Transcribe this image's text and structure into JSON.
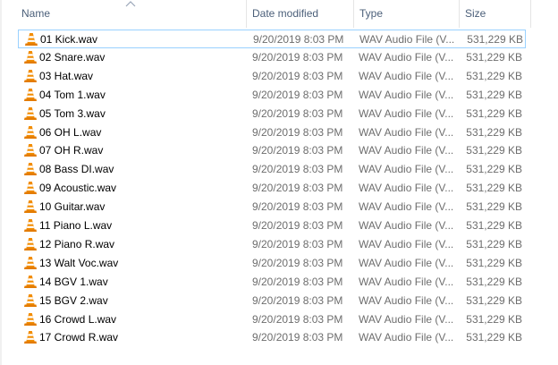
{
  "columns": {
    "name": "Name",
    "date": "Date modified",
    "type": "Type",
    "size": "Size"
  },
  "sort": {
    "column": "Name",
    "direction": "ascending"
  },
  "file_icon": "vlc-cone-icon",
  "files": [
    {
      "name": "01 Kick.wav",
      "date": "9/20/2019 8:03 PM",
      "type": "WAV Audio File (V...",
      "size": "531,229 KB"
    },
    {
      "name": "02 Snare.wav",
      "date": "9/20/2019 8:03 PM",
      "type": "WAV Audio File (V...",
      "size": "531,229 KB"
    },
    {
      "name": "03 Hat.wav",
      "date": "9/20/2019 8:03 PM",
      "type": "WAV Audio File (V...",
      "size": "531,229 KB"
    },
    {
      "name": "04 Tom 1.wav",
      "date": "9/20/2019 8:03 PM",
      "type": "WAV Audio File (V...",
      "size": "531,229 KB"
    },
    {
      "name": "05 Tom 3.wav",
      "date": "9/20/2019 8:03 PM",
      "type": "WAV Audio File (V...",
      "size": "531,229 KB"
    },
    {
      "name": "06 OH L.wav",
      "date": "9/20/2019 8:03 PM",
      "type": "WAV Audio File (V...",
      "size": "531,229 KB"
    },
    {
      "name": "07 OH R.wav",
      "date": "9/20/2019 8:03 PM",
      "type": "WAV Audio File (V...",
      "size": "531,229 KB"
    },
    {
      "name": "08 Bass DI.wav",
      "date": "9/20/2019 8:03 PM",
      "type": "WAV Audio File (V...",
      "size": "531,229 KB"
    },
    {
      "name": "09 Acoustic.wav",
      "date": "9/20/2019 8:03 PM",
      "type": "WAV Audio File (V...",
      "size": "531,229 KB"
    },
    {
      "name": "10 Guitar.wav",
      "date": "9/20/2019 8:03 PM",
      "type": "WAV Audio File (V...",
      "size": "531,229 KB"
    },
    {
      "name": "11 Piano L.wav",
      "date": "9/20/2019 8:03 PM",
      "type": "WAV Audio File (V...",
      "size": "531,229 KB"
    },
    {
      "name": "12 Piano R.wav",
      "date": "9/20/2019 8:03 PM",
      "type": "WAV Audio File (V...",
      "size": "531,229 KB"
    },
    {
      "name": "13 Walt Voc.wav",
      "date": "9/20/2019 8:03 PM",
      "type": "WAV Audio File (V...",
      "size": "531,229 KB"
    },
    {
      "name": "14 BGV 1.wav",
      "date": "9/20/2019 8:03 PM",
      "type": "WAV Audio File (V...",
      "size": "531,229 KB"
    },
    {
      "name": "15 BGV 2.wav",
      "date": "9/20/2019 8:03 PM",
      "type": "WAV Audio File (V...",
      "size": "531,229 KB"
    },
    {
      "name": "16 Crowd L.wav",
      "date": "9/20/2019 8:03 PM",
      "type": "WAV Audio File (V...",
      "size": "531,229 KB"
    },
    {
      "name": "17 Crowd R.wav",
      "date": "9/20/2019 8:03 PM",
      "type": "WAV Audio File (V...",
      "size": "531,229 KB"
    }
  ]
}
